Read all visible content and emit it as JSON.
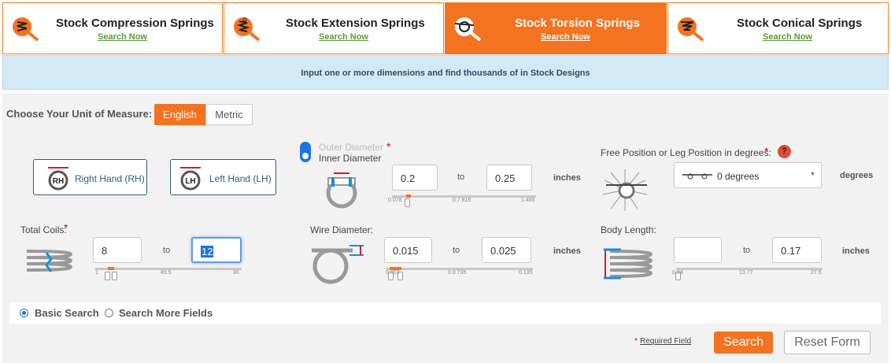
{
  "tabs": [
    {
      "title": "Stock Compression Springs",
      "sub": "Search Now"
    },
    {
      "title": "Stock Extension Springs",
      "sub": "Search Now"
    },
    {
      "title": "Stock Torsion Springs",
      "sub": "Search Now"
    },
    {
      "title": "Stock Conical Springs",
      "sub": "Search Now"
    }
  ],
  "banner": "Input one or more dimensions and find thousands of in Stock Designs",
  "unit": {
    "label": "Choose Your Unit of Measure:",
    "english": "English",
    "metric": "Metric"
  },
  "hand": {
    "rh_badge": "RH",
    "rh": "Right Hand (RH)",
    "lh_badge": "LH",
    "lh": "Left Hand (LH)"
  },
  "diameter": {
    "outer": "Outer Diameter",
    "inner": "Inner Diameter",
    "star": "*",
    "min": "0.2",
    "to": "to",
    "max": "0.25",
    "unit": "inches",
    "ticks": [
      "0.078",
      "0.7 815",
      "1.485"
    ]
  },
  "free": {
    "label": "Free Position or Leg Position in degrees:",
    "star": "*",
    "help": "?",
    "value": "0 degrees",
    "unit": "degrees"
  },
  "coils": {
    "label": "Total Coils:",
    "star": "*",
    "min": "8",
    "to": "to",
    "max": "12",
    "ticks": [
      "1",
      "45.5",
      "90"
    ]
  },
  "wire": {
    "label": "Wire Diameter:",
    "min": "0.015",
    "to": "to",
    "max": "0.025",
    "unit": "inches",
    "ticks": [
      "0.003",
      "0.0 735",
      "0.135"
    ]
  },
  "body": {
    "label": "Body Length:",
    "min": "",
    "to": "to",
    "max": "0.17",
    "unit": "inches",
    "ticks": [
      "0.04",
      "13.77",
      "27.5"
    ]
  },
  "search_mode": {
    "basic": "Basic Search",
    "more": "Search More Fields"
  },
  "footer": {
    "req_star": "*",
    "required": "Required Field",
    "search": "Search",
    "reset": "Reset Form"
  },
  "colors": {
    "accent": "#f37320",
    "blue": "#2a5f84",
    "banner": "#d4e9f6"
  }
}
